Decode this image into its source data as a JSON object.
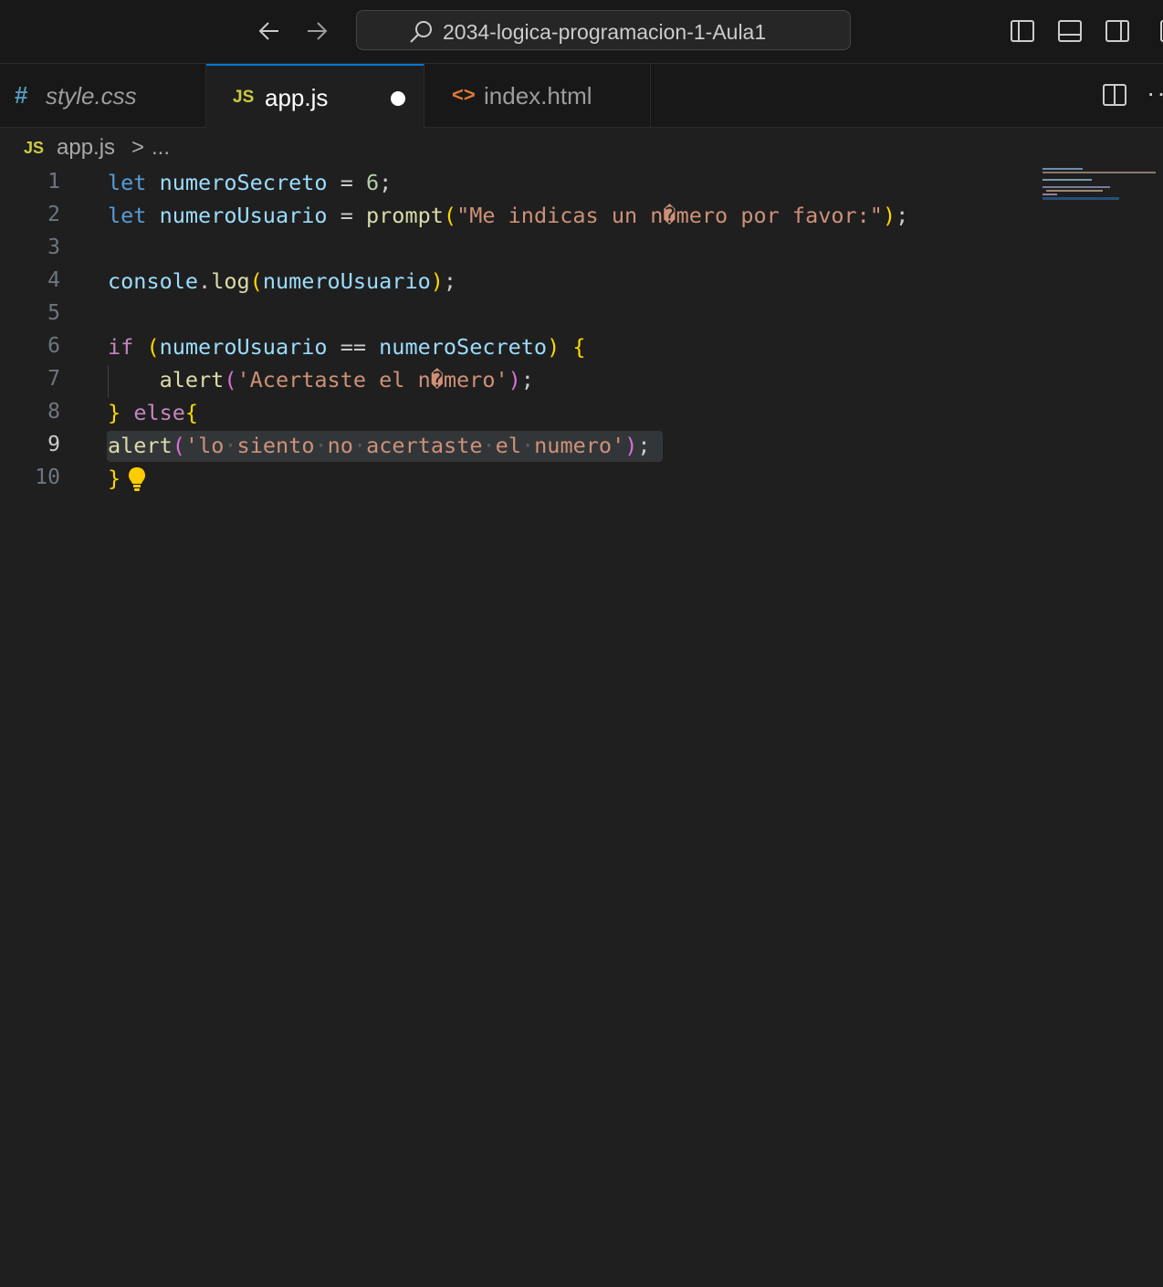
{
  "titlebar": {
    "search_text": "2034-logica-programacion-1-Aula1",
    "icons": [
      "arrow-left-icon",
      "arrow-right-icon",
      "search-icon",
      "toggle-primary-sidebar-icon",
      "toggle-panel-icon",
      "toggle-secondary-sidebar-icon",
      "customize-layout-icon"
    ]
  },
  "tabs": [
    {
      "icon_text": "#",
      "label": "style.css",
      "active": false
    },
    {
      "icon_text": "JS",
      "label": "app.js",
      "active": true,
      "dirty": true
    },
    {
      "icon_text": "<>",
      "label": "index.html",
      "active": false
    }
  ],
  "editor_actions": {
    "more": "···"
  },
  "breadcrumb": {
    "icon_text": "JS",
    "file": "app.js",
    "separator": ">",
    "rest": "..."
  },
  "editor": {
    "current_line": 9,
    "line_numbers": [
      "1",
      "2",
      "3",
      "4",
      "5",
      "6",
      "7",
      "8",
      "9",
      "10"
    ],
    "colors": {
      "keyword": "#569cd6",
      "control": "#c586c0",
      "variable": "#9cdcfe",
      "function": "#dcdcaa",
      "number": "#b5cea8",
      "string": "#ce9178",
      "bracket_gold": "#ffd700",
      "bracket_orchid": "#da70d6"
    },
    "tokens": {
      "let": "let",
      "numeroSecreto": "numeroSecreto",
      "numeroUsuario": "numeroUsuario",
      "eq": "=",
      "six": "6",
      "semi": ";",
      "prompt": "prompt",
      "lparen": "(",
      "rparen": ")",
      "prompt_str": "\"Me indicas un n�mero por favor:\"",
      "console": "console",
      "dot": ".",
      "log": "log",
      "if": "if",
      "eqeq": "==",
      "lbrace": "{",
      "rbrace": "}",
      "alert": "alert",
      "str_acertaste": "'Acertaste el n�mero'",
      "else": "else",
      "str_lo_siento": "'lo siento no acertaste el numero'"
    }
  }
}
